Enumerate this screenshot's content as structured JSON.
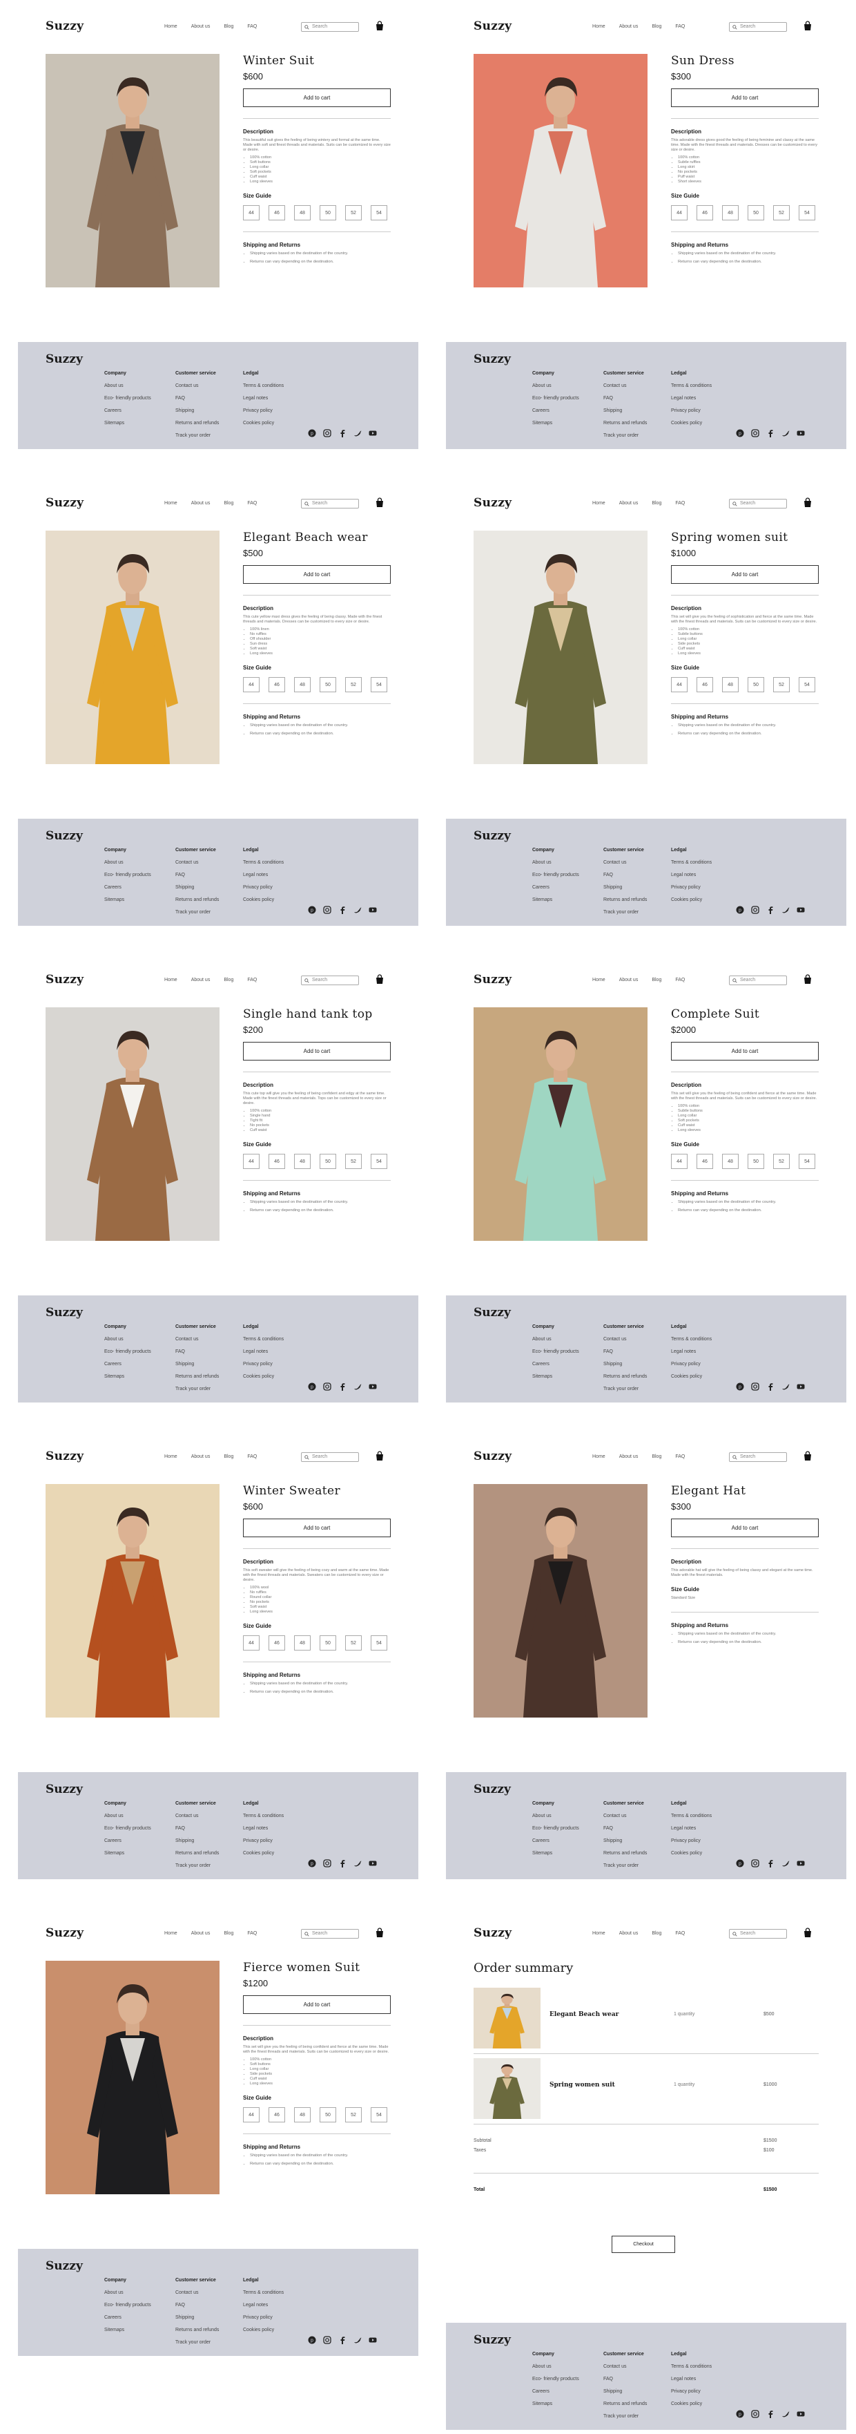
{
  "brand": "Suzzy",
  "nav": [
    "Home",
    "About us",
    "Blog",
    "FAQ"
  ],
  "search_placeholder": "Search",
  "add_to_cart": "Add to cart",
  "description_heading": "Description",
  "size_guide_heading": "Size Guide",
  "shipping_heading": "Shipping and Returns",
  "sizes": [
    "44",
    "46",
    "48",
    "50",
    "52",
    "54"
  ],
  "shipping_lines": [
    "Shipping varies based on the destination of the country.",
    "Returns can vary depending on the destination."
  ],
  "products": [
    {
      "name": "Winter Suit",
      "price": "$600",
      "desc": "This beautiful suit gives the feeling of being wintery and formal at the same time. Made with soft and finest threads and materials. Suits can be customized to every size or desire.",
      "bullets": [
        "100% cotton",
        "Soft buttons",
        "Long collar",
        "Soft pockets",
        "Cuff waist",
        "Long sleeves"
      ],
      "colors": [
        "#8b6f58",
        "#2a2a2c",
        "#c9c2b6"
      ]
    },
    {
      "name": "Sun Dress",
      "price": "$300",
      "desc": "This adorable dress gives good the feeling of being feminine and classy at the same time. Made with the finest threads and materials. Dresses can be customized to every size or desire.",
      "bullets": [
        "100% cotton",
        "Subtle ruffles",
        "Long skirt",
        "No pockets",
        "Puff waist",
        "Short sleeves"
      ],
      "colors": [
        "#e8e6e2",
        "#d9725c",
        "#e47d67"
      ]
    },
    {
      "name": "Elegant Beach wear",
      "price": "$500",
      "desc": "This cute yellow maxi dress gives the feeling of being classy. Made with the finest threads and materials. Dresses can be customized to every size or desire.",
      "bullets": [
        "100% linen",
        "No ruffles",
        "Off shoulder",
        "Sun dress",
        "Soft waist",
        "Long sleeves"
      ],
      "colors": [
        "#e4a52a",
        "#bfd4e2",
        "#e7dccb"
      ]
    },
    {
      "name": "Spring women suit",
      "price": "$1000",
      "desc": "This set will give you the feeling of sophistication and fierce at the same time. Made with the finest threads and materials. Suits can be customized to every size or desire.",
      "bullets": [
        "100% cotton",
        "Subtle buttons",
        "Long collar",
        "Side pockets",
        "Cuff waist",
        "Long sleeves"
      ],
      "colors": [
        "#6b6a3e",
        "#d8c39a",
        "#eae8e3"
      ]
    },
    {
      "name": "Single hand tank top",
      "price": "$200",
      "desc": "This cute top will give you the feeling of being confident and edgy at the same time. Made with the finest threads and materials. Tops can be customized to every size or desire.",
      "bullets": [
        "100% cotton",
        "Single hand",
        "Tight fit",
        "No pockets",
        "Cuff waist"
      ],
      "colors": [
        "#9a6a44",
        "#f4f2ee",
        "#d8d6d2"
      ]
    },
    {
      "name": "Complete Suit",
      "price": "$2000",
      "desc": "This set will give you the feeling of being confident and fierce at the same time. Made with the finest threads and materials. Suits can be customized to every size or desire.",
      "bullets": [
        "100% cotton",
        "Subtle buttons",
        "Long collar",
        "Soft pockets",
        "Cuff waist",
        "Long sleeves"
      ],
      "colors": [
        "#9fd6c2",
        "#4a2c2a",
        "#c7a77e"
      ]
    },
    {
      "name": "Winter Sweater",
      "price": "$600",
      "desc": "This soft sweater will give the feeling of being cozy and warm at the same time. Made with the finest threads and materials. Sweaters can be customized to every size or desire.",
      "bullets": [
        "100% wool",
        "No ruffles",
        "Round collar",
        "No pockets",
        "Soft waist",
        "Long sleeves"
      ],
      "colors": [
        "#b5501f",
        "#c9a070",
        "#e9d7b5"
      ]
    },
    {
      "name": "Elegant Hat",
      "price": "$300",
      "desc": "This adorable hat will give the feeling of being classy and elegant at the same time. Made with the finest materials.",
      "bullets": [],
      "size_note": "Standard Size",
      "colors": [
        "#4a332a",
        "#1e1b1b",
        "#b3937f"
      ]
    },
    {
      "name": "Fierce women Suit",
      "price": "$1200",
      "desc": "This set will give you the feeling of being confident and fierce at the same time. Made with the finest threads and materials. Suits can be customized to every size or desire.",
      "bullets": [
        "100% cotton",
        "Soft buttons",
        "Long collar",
        "Side pockets",
        "Cuff waist",
        "Long sleeves"
      ],
      "colors": [
        "#1d1d1f",
        "#d6d4d0",
        "#c98f6c"
      ]
    }
  ],
  "footer": {
    "company_heading": "Company",
    "company": [
      "About us",
      "Eco- friendly products",
      "Careers",
      "Sitemaps"
    ],
    "service_heading": "Customer service",
    "service": [
      "Contact us",
      "FAQ",
      "Shipping",
      "Returns and refunds",
      "Track your order"
    ],
    "legal_heading": "Ledgal",
    "legal": [
      "Terms & conditions",
      "Legal notes",
      "Privacy policy",
      "Cookies policy"
    ],
    "social_icons": [
      "pinterest-icon",
      "instagram-icon",
      "facebook-icon",
      "twitter-icon",
      "youtube-icon"
    ]
  },
  "order": {
    "title": "Order summary",
    "items": [
      {
        "name": "Elegant Beach wear",
        "qty": "1 quantity",
        "price": "$500"
      },
      {
        "name": "Spring women suit",
        "qty": "1 quantity",
        "price": "$1000"
      }
    ],
    "subtotal_label": "Subtotal",
    "subtotal": "$1500",
    "taxes_label": "Taxes",
    "taxes": "$100",
    "total_label": "Total",
    "total": "$1500",
    "checkout_label": "Checkout"
  }
}
